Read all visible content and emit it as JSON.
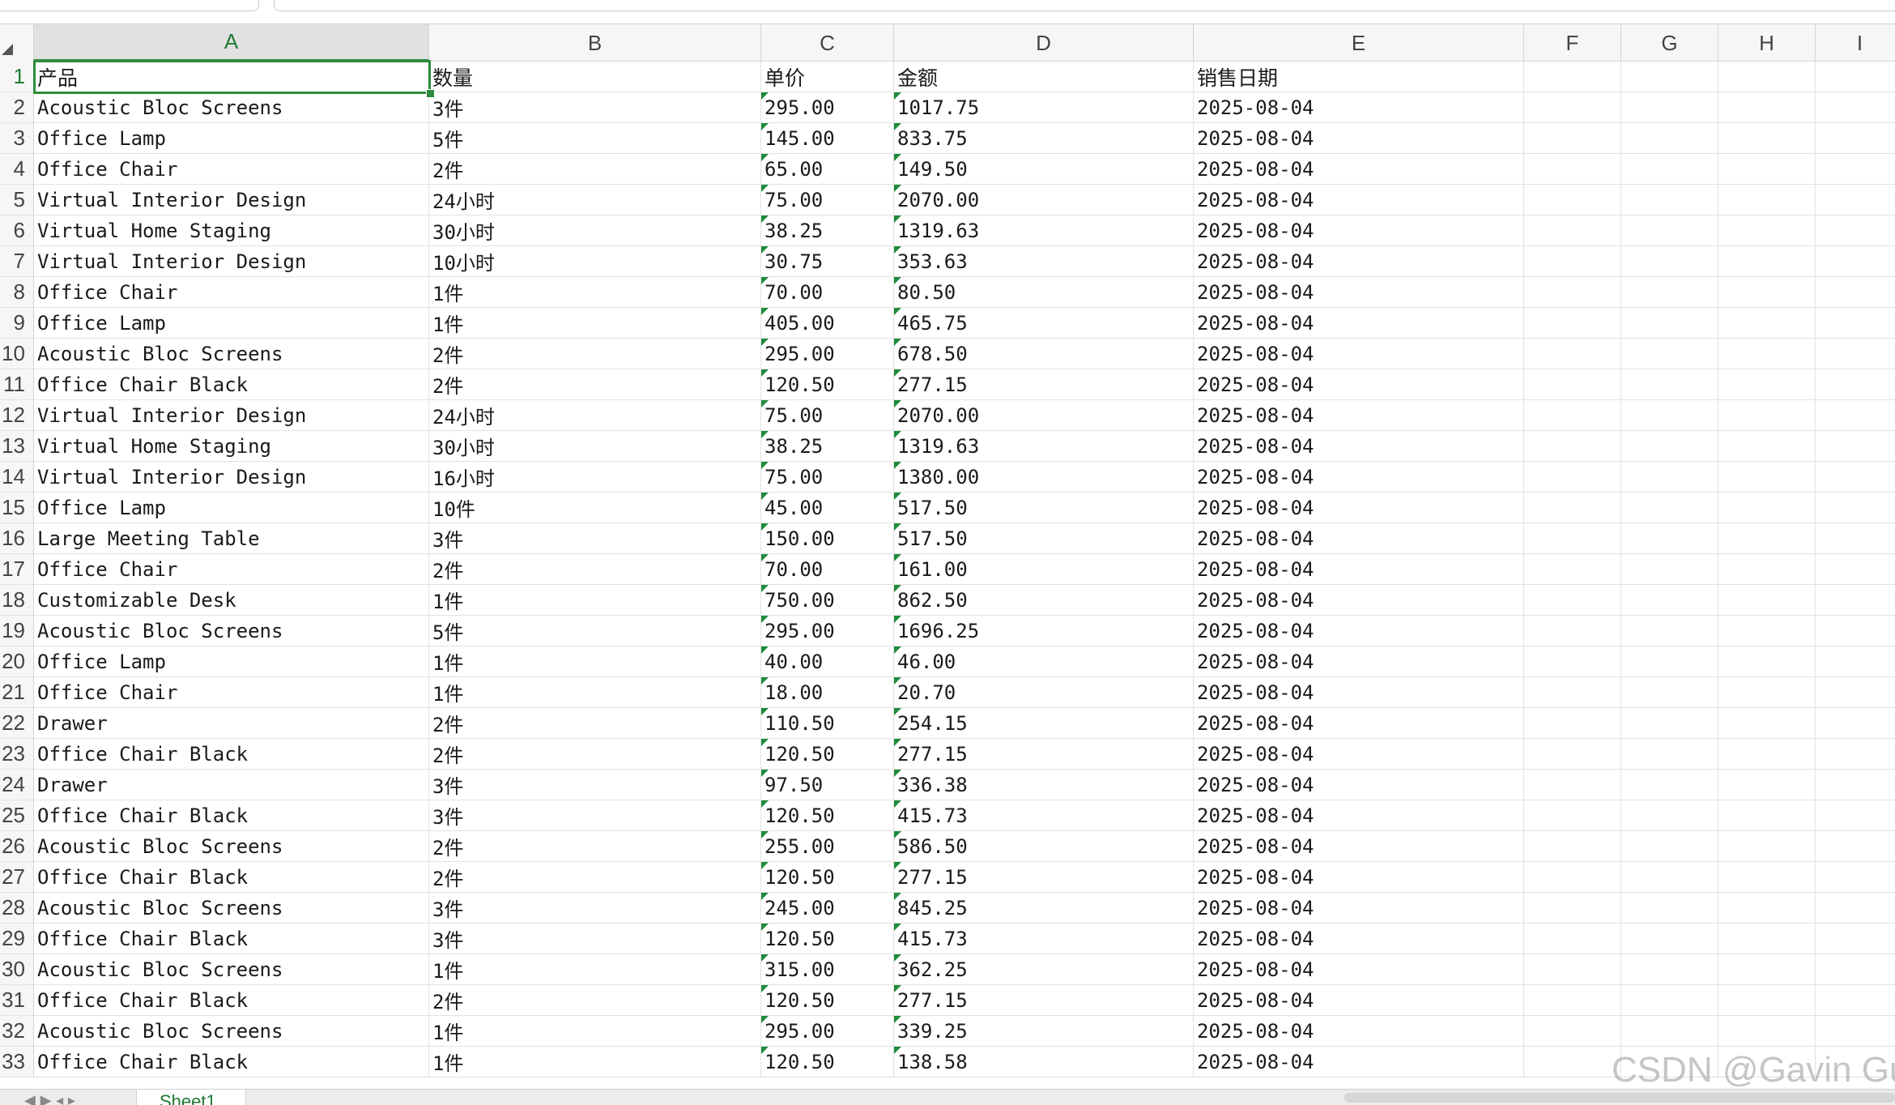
{
  "sheet": {
    "column_headers": [
      "A",
      "B",
      "C",
      "D",
      "E",
      "F",
      "G",
      "H",
      "I"
    ],
    "active_cell": "A1",
    "header_row": [
      "产品",
      "数量",
      "单价",
      "金额",
      "销售日期"
    ],
    "rows": [
      [
        "Acoustic Bloc Screens",
        "3件",
        "295.00",
        "1017.75",
        "2025-08-04"
      ],
      [
        "Office Lamp",
        "5件",
        "145.00",
        "833.75",
        "2025-08-04"
      ],
      [
        "Office Chair",
        "2件",
        "65.00",
        "149.50",
        "2025-08-04"
      ],
      [
        "Virtual Interior Design",
        "24小时",
        "75.00",
        "2070.00",
        "2025-08-04"
      ],
      [
        "Virtual Home Staging",
        "30小时",
        "38.25",
        "1319.63",
        "2025-08-04"
      ],
      [
        "Virtual Interior Design",
        "10小时",
        "30.75",
        "353.63",
        "2025-08-04"
      ],
      [
        "Office Chair",
        "1件",
        "70.00",
        "80.50",
        "2025-08-04"
      ],
      [
        "Office Lamp",
        "1件",
        "405.00",
        "465.75",
        "2025-08-04"
      ],
      [
        "Acoustic Bloc Screens",
        "2件",
        "295.00",
        "678.50",
        "2025-08-04"
      ],
      [
        "Office Chair Black",
        "2件",
        "120.50",
        "277.15",
        "2025-08-04"
      ],
      [
        "Virtual Interior Design",
        "24小时",
        "75.00",
        "2070.00",
        "2025-08-04"
      ],
      [
        "Virtual Home Staging",
        "30小时",
        "38.25",
        "1319.63",
        "2025-08-04"
      ],
      [
        "Virtual Interior Design",
        "16小时",
        "75.00",
        "1380.00",
        "2025-08-04"
      ],
      [
        "Office Lamp",
        "10件",
        "45.00",
        "517.50",
        "2025-08-04"
      ],
      [
        "Large Meeting Table",
        "3件",
        "150.00",
        "517.50",
        "2025-08-04"
      ],
      [
        "Office Chair",
        "2件",
        "70.00",
        "161.00",
        "2025-08-04"
      ],
      [
        "Customizable Desk",
        "1件",
        "750.00",
        "862.50",
        "2025-08-04"
      ],
      [
        "Acoustic Bloc Screens",
        "5件",
        "295.00",
        "1696.25",
        "2025-08-04"
      ],
      [
        "Office Lamp",
        "1件",
        "40.00",
        "46.00",
        "2025-08-04"
      ],
      [
        "Office Chair",
        "1件",
        "18.00",
        "20.70",
        "2025-08-04"
      ],
      [
        "Drawer",
        "2件",
        "110.50",
        "254.15",
        "2025-08-04"
      ],
      [
        "Office Chair Black",
        "2件",
        "120.50",
        "277.15",
        "2025-08-04"
      ],
      [
        "Drawer",
        "3件",
        "97.50",
        "336.38",
        "2025-08-04"
      ],
      [
        "Office Chair Black",
        "3件",
        "120.50",
        "415.73",
        "2025-08-04"
      ],
      [
        "Acoustic Bloc Screens",
        "2件",
        "255.00",
        "586.50",
        "2025-08-04"
      ],
      [
        "Office Chair Black",
        "2件",
        "120.50",
        "277.15",
        "2025-08-04"
      ],
      [
        "Acoustic Bloc Screens",
        "3件",
        "245.00",
        "845.25",
        "2025-08-04"
      ],
      [
        "Office Chair Black",
        "3件",
        "120.50",
        "415.73",
        "2025-08-04"
      ],
      [
        "Acoustic Bloc Screens",
        "1件",
        "315.00",
        "362.25",
        "2025-08-04"
      ],
      [
        "Office Chair Black",
        "2件",
        "120.50",
        "277.15",
        "2025-08-04"
      ],
      [
        "Acoustic Bloc Screens",
        "1件",
        "295.00",
        "339.25",
        "2025-08-04"
      ],
      [
        "Office Chair Black",
        "1件",
        "120.50",
        "138.58",
        "2025-08-04"
      ]
    ],
    "text_number_flag_color": "#1f8b3c",
    "selection_color": "#2e8b3d"
  },
  "sheet_tabs": {
    "nav_arrows": "◀ ▶ ◂ ▸",
    "active_tab_label": "Sheet1"
  },
  "watermark": "CSDN @Gavin Gu"
}
